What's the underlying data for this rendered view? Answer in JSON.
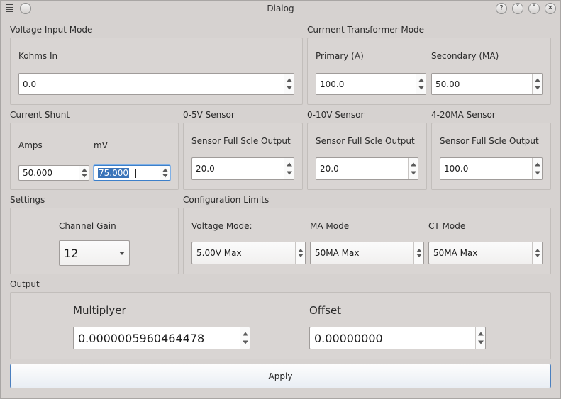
{
  "window": {
    "title": "Dialog",
    "help_btn": "?",
    "min_btn": "˅",
    "max_btn": "˄",
    "close_btn": "✕"
  },
  "voltage_input": {
    "title": "Voltage Input Mode",
    "kohms_label": "Kohms In",
    "kohms_value": "0.0"
  },
  "ct_mode": {
    "title": "Currnent Transformer Mode",
    "primary_label": "Primary (A)",
    "primary_value": "100.0",
    "secondary_label": "Secondary (MA)",
    "secondary_value": "50.00"
  },
  "current_shunt": {
    "title": "Current Shunt",
    "amps_label": "Amps",
    "amps_value": "50.000",
    "mv_label": "mV",
    "mv_value": "75.000"
  },
  "sensor_05v": {
    "title": "0-5V Sensor",
    "label": "Sensor Full Scle Output",
    "value": "20.0"
  },
  "sensor_010v": {
    "title": "0-10V Sensor",
    "label": "Sensor Full Scle Output",
    "value": "20.0"
  },
  "sensor_420ma": {
    "title": "4-20MA Sensor",
    "label": "Sensor Full Scle Output",
    "value": "100.0"
  },
  "settings": {
    "title": "Settings",
    "gain_label": "Channel Gain",
    "gain_value": "12"
  },
  "config_limits": {
    "title": "Configuration Limits",
    "voltage_label": "Voltage Mode:",
    "voltage_value": "5.00V Max",
    "ma_label": "MA Mode",
    "ma_value": "50MA Max",
    "ct_label": "CT Mode",
    "ct_value": "50MA Max"
  },
  "output": {
    "title": "Output",
    "multiplyer_label": "Multiplyer",
    "multiplyer_value": "0.0000005960464478",
    "offset_label": "Offset",
    "offset_value": "0.00000000"
  },
  "apply_label": "Apply"
}
